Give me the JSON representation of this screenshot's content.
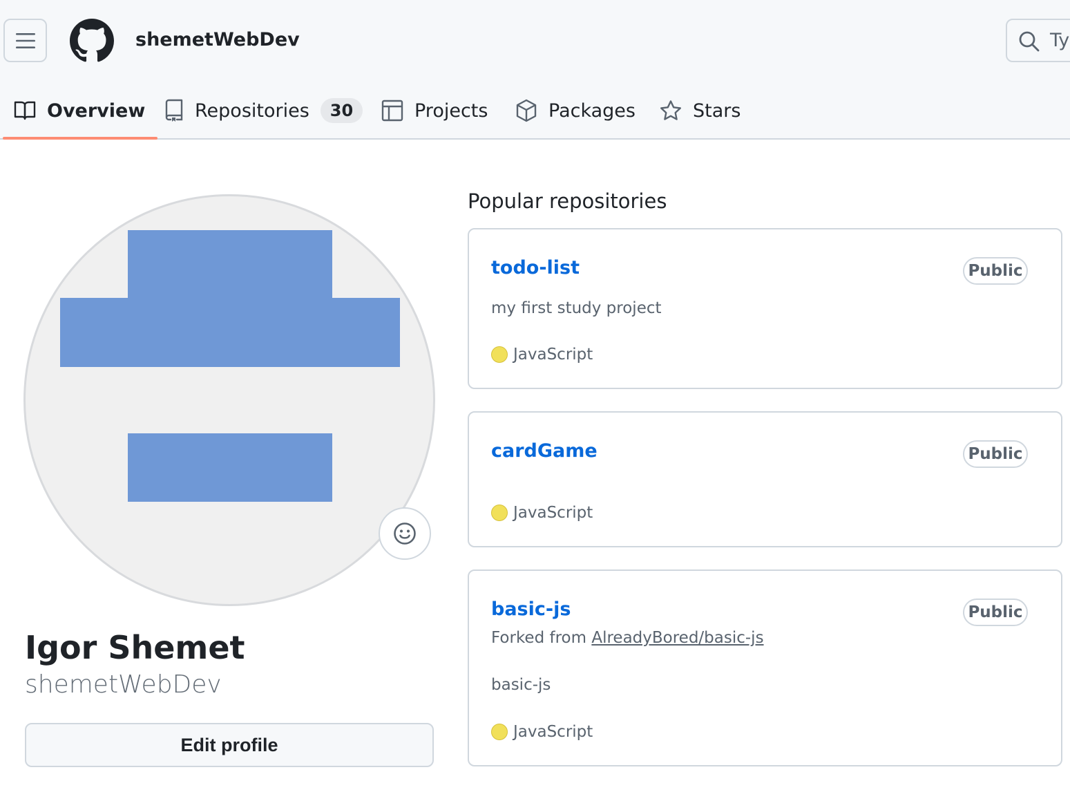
{
  "header": {
    "owner": "shemetWebDev",
    "search_placeholder": "Ty"
  },
  "tabs": [
    {
      "label": "Overview",
      "selected": true,
      "icon": "book-icon"
    },
    {
      "label": "Repositories",
      "count": "30",
      "icon": "repo-icon"
    },
    {
      "label": "Projects",
      "icon": "table-icon"
    },
    {
      "label": "Packages",
      "icon": "package-icon"
    },
    {
      "label": "Stars",
      "icon": "star-icon"
    }
  ],
  "profile": {
    "name": "Igor Shemet",
    "login": "shemetWebDev",
    "edit_label": "Edit profile"
  },
  "popular": {
    "title": "Popular repositories",
    "repos": [
      {
        "name": "todo-list",
        "visibility": "Public",
        "description": "my first study project",
        "language": "JavaScript",
        "language_color": "#f1e05a"
      },
      {
        "name": "cardGame",
        "visibility": "Public",
        "language": "JavaScript",
        "language_color": "#f1e05a"
      },
      {
        "name": "basic-js",
        "visibility": "Public",
        "fork_prefix": "Forked from",
        "fork_source": "AlreadyBored/basic-js",
        "description": "basic-js",
        "language": "JavaScript",
        "language_color": "#f1e05a"
      }
    ]
  },
  "colors": {
    "accent_link": "#0969da",
    "tab_underline": "#fd8c73",
    "identicon": "#6f98d6"
  }
}
